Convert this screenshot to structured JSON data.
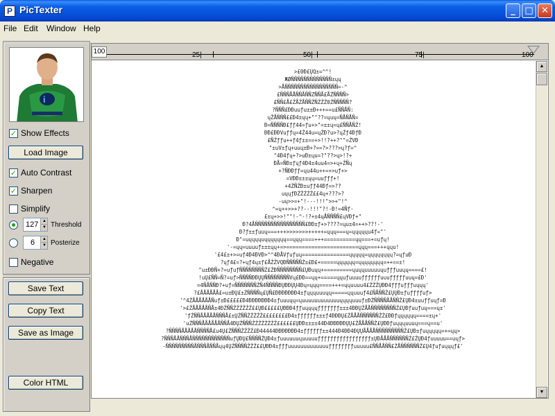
{
  "window": {
    "title": "PicTexter"
  },
  "menu": [
    "File",
    "Edit",
    "Window",
    "Help"
  ],
  "left": {
    "show_effects": {
      "label": "Show Effects",
      "checked": true
    },
    "load_image": "Load Image",
    "auto_contrast": {
      "label": "Auto Contrast",
      "checked": true
    },
    "sharpen": {
      "label": "Sharpen",
      "checked": true
    },
    "simplify": {
      "label": "Simplify",
      "checked": false
    },
    "threshold": {
      "label": "Threshold",
      "value": "127",
      "selected": true
    },
    "posterize": {
      "label": "Posterize",
      "value": "6",
      "selected": false
    },
    "negative": {
      "label": "Negative",
      "checked": false
    },
    "save_text": "Save Text",
    "copy_text": "Copy Text",
    "save_as_image": "Save as Image",
    "color_html": "Color HTML"
  },
  "ruler": {
    "start": "100",
    "ticks": [
      "25|",
      "50|",
      "75|",
      "100"
    ]
  },
  "art_lines": [
    ">£0Đ£ŲQ±=^^!",
    "ЖØÑÑÑÑÑÑÑÑÑÑÑÑÑ±ųų",
    ">ÅÑÑÑÑÑÑÑÑÑÑÑÑÑÑÑÑÑ=-^",
    "£ÑÑÑÅÅÑÑÅÑÑZÑÑÅ£ÅŹÑÑÑÑ>",
    "£ÑÑ£Å£ŹÅŹÅÑÑŹÑŹŹŹ0ŹÑÑÑÑÑ?",
    "?ÑÑÑ£ÐÐuuƒu±±Đ+++==u£ÑÑÅÑ:",
    "ųŽÅÑÑÑ££Đ4±ųų+\"\"??=ųuų=ÑÅÑÅÑ=",
    "Đ=ÑÑÑÑÐ£ƒƒ44=ƒu+>\"=±±ų=ų£ÑÑÅÑŹ!",
    "ĐĐ£ĐĐVuƒƒų=4Ź44u=ųŹĐ?u>?ųŹƒ4ĐƒĐ",
    "£ÑŹƒƒu++ƒ4ƒ±±==+>!!?++?\"\"=ŹVĐ",
    "\"±uV±ƒų+uuų±Đ+?==?>???>ų?ƒ=^",
    "\"4Đ4ƒų+?>uĐ±ųu=?\"??>ų>!?+",
    "ĐÅ=ÑĐ±ƒųƒ4Đ4±4uu4=>+ų+ŹÑų",
    "+?ÑĐĐƒƒ=ųu44u++=+>uƒ+>",
    "=VĐĐ±±±ųų=uuƒƒƒ+!",
    "+4ŹÑŹĐ±uƒƒ44Đƒ=>??",
    "uųųƒĐŹŹŹŹŹ££4ų+???>?",
    "-uų>>=+\"!---!!!\">>+\"!^",
    "^=ų++>>+??--!!!\"?!-Đ!=4Ñƒ-",
    "£±ų+>>!\"\"!-^-!?+±4ųÅÑÑÑÑ£ųVĐƒ+\"",
    "Đ?4ÅÑÑÑÑÑÑÑÑÑÑÑÑÑÑÑÑ£ĐĐ±ƒ+>????=ųu±4=++>??!-'",
    "Đ?ƒ±±ƒuuų===+++>>>>>>>+++++=ųųų===ų=ųųųųųu4ƒ=\"'",
    "Đ\"=uųųųųuųųųųųųų==ųųų====+++==========ųų===+=uƒų!",
    "'-=ųų=uuuuƒ±±±ųų+=>=======================ųųų===+++ųųu!",
    "'£4£±+>=uƒ4Đ4ĐVĐ>^^4ĐÅVƒuƒuų===============ųųųųų=ųųųųųųųų?=ųƒuĐ",
    "?ųƒ4£=?+ųƒ4ų±ƒ£ÅŹŹVQĐÑÑÑÑÑŹ±£Đ£+=====ųųųųųų=ųųųųųųųų=++==±!",
    "\"u±ĐĐÑ+?=uƒuƒÑÑÑÑÑÑÑÑŹ£ŹĐÑÑÑÑÑÑÑÑ£ŲĐuųų+=========ųuųųuuuuuųuƒƒƒuuųų====£!",
    "!uŲ£ÑÑ=Ñ?=uƒ>ÑÑÑÑĐĐŲŲÑÑÑÑÑÑÑÑVų£ĐĐ==ųų+=====ųųuƒuuuuƒƒƒƒƒƒuuuƒƒƒƒƒuuų=£Đ'",
    "=4ÑÅÑÑĐ?+uƒ=ÑÑÑÑÑÑÑŹÑ4ÑÑÑÑÐŲĐĐŲŲ4Đų=ųųų====+++=ųųuuuu4£ŹŹŹŲĐĐ4ƒƒƒuƒƒƒuųųų'",
    "?£ÅÅÅÅÅÅ£=u±ĐŲ£±ŹÑÑÑÑų£ŲÑ£ĐĐĐĐĐĐĐ4±ƒųųųuuuųų=====ųųuuuƒ4£ÑÅÑÑŹ£ŲŲĐ±ƒuƒƒƒƒuƒ>",
    "'^4ŹÅÅÅÅÅÅÑuƒ±Đ£££££Đ4ĐĐĐĐĐĐĐ4±ƒuuuųų=ųuuuuuuuuuuuuųųųųuuuƒ±ĐŹÑÑÑÑÅÅÑÑŹ£ŲĐ4±uuƒƒuųƒ=Đ",
    "'>£ŹÅÅÅÅÅÑÅ±4ĐŹÑÑŹŹŹŹŹŹ££ŲĐ£££££ŲĐĐĐ4ƒƒuųųųųƒƒƒƒƒƒƒ±±±4ĐĐŲŹÅÅÑÑÑÑÑÑÑÑŹ£ŲĐƒuuƒuų===ų±'",
    "'ƒŹÑÑÅÅÅÅÅÑÑÑÅ£±ŲŹÑÑŹŹŹŹŹ££££££££Đ4±ƒƒƒƒƒƒ±±±ƒ4ĐĐĐŲ£ŹÅÅÅÑÑÑÑÑÑŹŹ£ĐĐƒųųųųųų====±ų+'",
    "'uŹÑÑÑÅÅÅÅÅÅÑÑÅ4ĐŲŹÑÑÑŹŹŹŹŹŹŹŹ££££££ŲĐĐ±±±±44Đ4ĐĐĐĐĐŲŲ£ŹÅÅÅÑÑŹ£ŲĐĐƒuųųųuuuų===ų==u'",
    "?ÑÑÑÑÅÅÅÅÅÑÑÑÑÅ£u4Ų£ŹÑÑÑŹŹŹŹ£Đ44444ĐĐĐĐĐĐĐ4±ƒƒƒƒƒƒ±±444Đ4ĐĐ4ĐŲŲÅÅÅÅÑÑÑÑÑÑÑÑÑŹ£ŲĐ±ƒuųųųųų=+=ųų>",
    "?ÑÑÑÅÅÑÑÑÅÑÑÑÑÑÑÑÑÑÑÑÑuƒŲĐŲ£ÑÑÑÑŹŲĐ4±ƒuuuuuuųuuuuuƒƒƒƒƒƒƒƒƒƒƒƒƒƒƒƒƒ±ŲĐÅÅÅÑÑÑÑÑÑŹ£ŹŲĐ4ƒuuuuu==uųƒ>",
    "-ÑÑÑÑÑÑÑÑÑÅÑÑÑÅÑÑÅųų4ŲŹÑÑÑÑŹŹŹ££ŲĐĐ4±ƒƒƒuuuuuuuuuuuuuƒƒƒƒƒƒƒƒuuuuu£ÑÑÅÅÑÑ£ŹÅÑÑÑÑÑÑŹ£Ų4ƒuƒuųųųƒ£'"
  ]
}
